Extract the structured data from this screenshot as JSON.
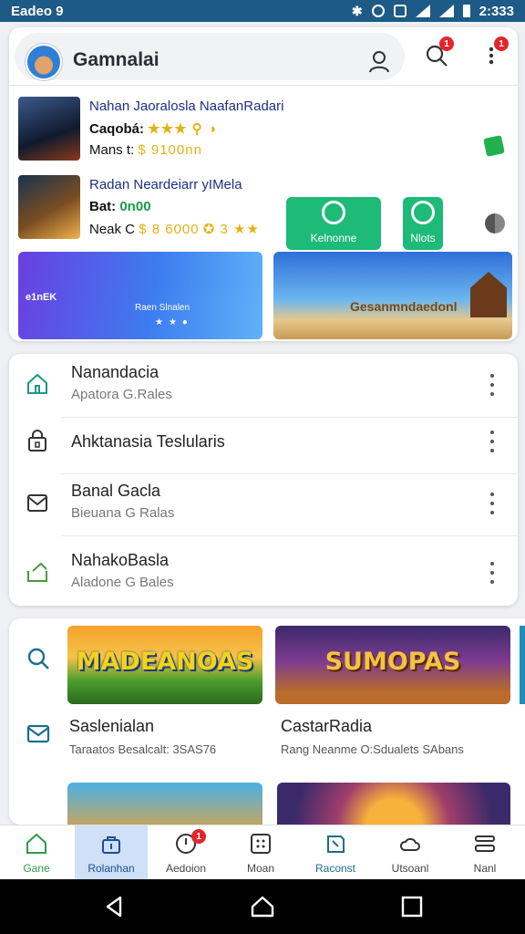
{
  "status_bar": {
    "left_text": "Eadeo 9",
    "time": "2:333"
  },
  "app_bar": {
    "title": "Gamnalai",
    "profile_badge": "",
    "search_badge": "1",
    "menu_badge": "1"
  },
  "featured_games": [
    {
      "title": "Nahan Jaoralosla NaafanRadari",
      "line2_label": "Caqobá:",
      "line2_rating": "★★★ ⚲ ◑",
      "line3_label": "Mans t:",
      "line3_value": "$ 9100nn"
    },
    {
      "title": "Radan Neardeiarr yIMela",
      "line2_label": "Bat:",
      "line2_value": "0n00",
      "line3_label": "Neak C",
      "line3_value": "$ 8 6000",
      "line3_rating": "✪ 3 ★★"
    }
  ],
  "actions": [
    {
      "label": "Kelnonne",
      "color": "#1dba78"
    },
    {
      "label": "Nlots",
      "color": "#1dba78"
    }
  ],
  "banners": [
    {
      "tag": "e1nEK",
      "caption": "Raen Slnalen"
    },
    {
      "caption": "Gesanmndaedonl"
    }
  ],
  "list": [
    {
      "title": "Nanandacia",
      "subtitle": "Apatora G.Rales",
      "icon": "house-icon"
    },
    {
      "title": "Ahktanasia Teslularis",
      "subtitle": "",
      "icon": "lock-icon"
    },
    {
      "title": "Banal Gacla",
      "subtitle": "Bieuana G Ralas",
      "icon": "mail-icon"
    },
    {
      "title": "NahakoBasla",
      "subtitle": "Aladone G Bales",
      "icon": "share-icon"
    }
  ],
  "tiles": [
    {
      "logo": "MADEANOAS",
      "name": "Saslenialan",
      "desc": "Taraatos Besalcalt: 3SAS76"
    },
    {
      "logo": "SUMOPAS",
      "name": "CastarRadia",
      "desc": "Rang Neanme O:Sdualets SAbans"
    }
  ],
  "bottom_nav": [
    {
      "label": "Gane",
      "icon": "home-icon",
      "active": false
    },
    {
      "label": "Rolanhan",
      "icon": "bag-icon",
      "active": true
    },
    {
      "label": "Aedoion",
      "icon": "clock-icon",
      "active": false,
      "badge": "1"
    },
    {
      "label": "Moan",
      "icon": "grid-icon",
      "active": false
    },
    {
      "label": "Raconst",
      "icon": "tag-icon",
      "active": false
    },
    {
      "label": "Utsoanl",
      "icon": "cloud-icon",
      "active": false
    },
    {
      "label": "Nanl",
      "icon": "menu-icon",
      "active": false
    }
  ],
  "colors": {
    "accent": "#1c4f9a",
    "status_bar": "#1d5a86",
    "green": "#1dba78",
    "badge": "#e3262d"
  }
}
